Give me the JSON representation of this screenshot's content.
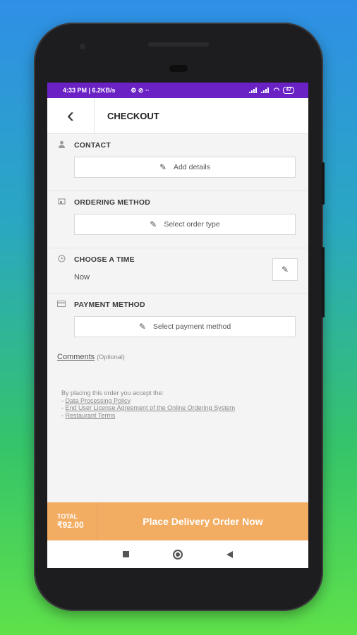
{
  "status": {
    "time": "4:33 PM | 6.2KB/s",
    "extra_icons": "⚙ ⊘ ··",
    "battery": "47"
  },
  "header": {
    "back_symbol": "‹",
    "title": "CHECKOUT"
  },
  "contact": {
    "label": "CONTACT",
    "button": "Add details"
  },
  "ordering": {
    "label": "ORDERING METHOD",
    "button": "Select order type"
  },
  "time": {
    "label": "CHOOSE A TIME",
    "value": "Now"
  },
  "payment": {
    "label": "PAYMENT METHOD",
    "button": "Select payment method"
  },
  "comments": {
    "link": "Comments",
    "optional": "(Optional)"
  },
  "terms": {
    "intro": "By placing this order you accept the:",
    "items": [
      "Data Processing Policy",
      "End User License Agreement of the Online Ordering System",
      "Restaurant Terms"
    ]
  },
  "footer": {
    "total_label": "TOTAL",
    "total_value": "₹92.00",
    "place_order": "Place Delivery Order Now"
  },
  "icons": {
    "user": "user-icon",
    "ordering": "store-icon",
    "clock": "clock-icon",
    "card": "credit-card-icon",
    "pencil": "pencil-icon"
  },
  "colors": {
    "status_bar": "#6a22c4",
    "footer_accent": "#f3ad63"
  }
}
